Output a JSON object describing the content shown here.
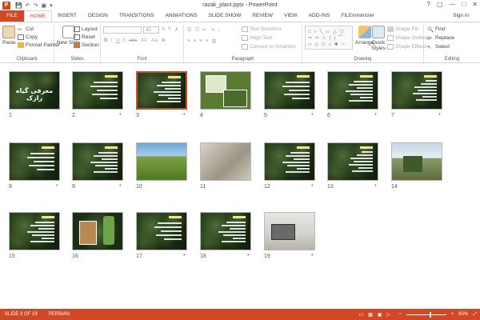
{
  "titlebar": {
    "app_icon_letter": "P",
    "title": "razak_plant.pptx - PowerPoint",
    "qat": [
      "💾",
      "↶",
      "↷",
      "▣",
      "▾"
    ],
    "controls": [
      "?",
      "▢",
      "—",
      "□",
      "✕"
    ]
  },
  "tabs": [
    "FILE",
    "HOME",
    "INSERT",
    "DESIGN",
    "TRANSITIONS",
    "ANIMATIONS",
    "SLIDE SHOW",
    "REVIEW",
    "VIEW",
    "ADD-INS",
    "FILEminimizer"
  ],
  "active_tab": "HOME",
  "signin": "Sign in",
  "ribbon": {
    "clipboard": {
      "label": "Clipboard",
      "paste": "Paste",
      "cut": "Cut",
      "copy": "Copy",
      "format_painter": "Format Painter"
    },
    "slides": {
      "label": "Slides",
      "new_slide": "New Slide",
      "layout": "Layout",
      "reset": "Reset",
      "section": "Section"
    },
    "font": {
      "label": "Font",
      "font_name": "",
      "font_size": "42",
      "buttons": [
        "A",
        "A",
        "✗",
        "B",
        "I",
        "U",
        "S",
        "abc",
        "AV",
        "Aa",
        "A"
      ]
    },
    "paragraph": {
      "label": "Paragraph",
      "text_direction": "Text Direction",
      "align_text": "Align Text",
      "convert_smartart": "Convert to SmartArt"
    },
    "drawing": {
      "label": "Drawing",
      "arrange": "Arrange",
      "quick_styles": "Quick Styles",
      "shape_fill": "Shape Fill",
      "shape_outline": "Shape Outline",
      "shape_effects": "Shape Effects"
    },
    "editing": {
      "label": "Editing",
      "find": "Find",
      "replace": "Replace",
      "select": "Select"
    }
  },
  "slides": [
    {
      "num": "1",
      "kind": "title",
      "text": "معرفی گیاه رازک",
      "star": ""
    },
    {
      "num": "2",
      "kind": "text",
      "star": "*"
    },
    {
      "num": "3",
      "kind": "text",
      "star": "*",
      "selected": true
    },
    {
      "num": "4",
      "kind": "leaf",
      "star": ""
    },
    {
      "num": "5",
      "kind": "text",
      "star": "*"
    },
    {
      "num": "6",
      "kind": "text",
      "star": "*"
    },
    {
      "num": "7",
      "kind": "text",
      "star": "*"
    },
    {
      "num": "8",
      "kind": "text",
      "star": "*"
    },
    {
      "num": "9",
      "kind": "text",
      "star": "*"
    },
    {
      "num": "10",
      "kind": "field",
      "star": ""
    },
    {
      "num": "11",
      "kind": "gray",
      "star": ""
    },
    {
      "num": "12",
      "kind": "text",
      "star": "*"
    },
    {
      "num": "13",
      "kind": "text",
      "star": "*"
    },
    {
      "num": "14",
      "kind": "machine",
      "star": ""
    },
    {
      "num": "15",
      "kind": "text",
      "star": ""
    },
    {
      "num": "16",
      "kind": "bottles",
      "star": ""
    },
    {
      "num": "17",
      "kind": "text",
      "star": "*"
    },
    {
      "num": "18",
      "kind": "text",
      "star": "*"
    },
    {
      "num": "19",
      "kind": "laptop",
      "star": "*"
    }
  ],
  "statusbar": {
    "slide_info": "SLIDE 3 OF 19",
    "language": "PERSIAN",
    "zoom": "60%"
  },
  "colors": {
    "accent": "#d24726",
    "selected_border": "#c5522d"
  }
}
